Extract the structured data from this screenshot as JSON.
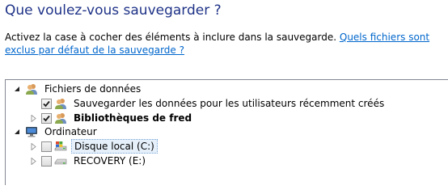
{
  "page": {
    "title": "Que voulez-vous sauvegarder ?",
    "description": "Activez la case à cocher des éléments à inclure dans la sauvegarde. ",
    "help_link": "Quels fichiers sont exclus par défaut de la sauvegarde ?"
  },
  "tree": {
    "nodes": [
      {
        "label": "Fichiers de données",
        "icon": "users-icon",
        "expander": "expanded",
        "checkbox": "none"
      },
      {
        "label": "Sauvegarder les données pour les utilisateurs récemment créés",
        "icon": "users-icon",
        "expander": "none",
        "checkbox": "checked"
      },
      {
        "label": "Bibliothèques de fred",
        "icon": "user-icon",
        "expander": "collapsed",
        "checkbox": "checked"
      },
      {
        "label": "Ordinateur",
        "icon": "computer-icon",
        "expander": "expanded",
        "checkbox": "none"
      },
      {
        "label": "Disque local (C:)",
        "icon": "windows-drive-icon",
        "expander": "collapsed",
        "checkbox": "unchecked"
      },
      {
        "label": "RECOVERY (E:)",
        "icon": "drive-icon",
        "expander": "collapsed",
        "checkbox": "unchecked"
      }
    ]
  }
}
